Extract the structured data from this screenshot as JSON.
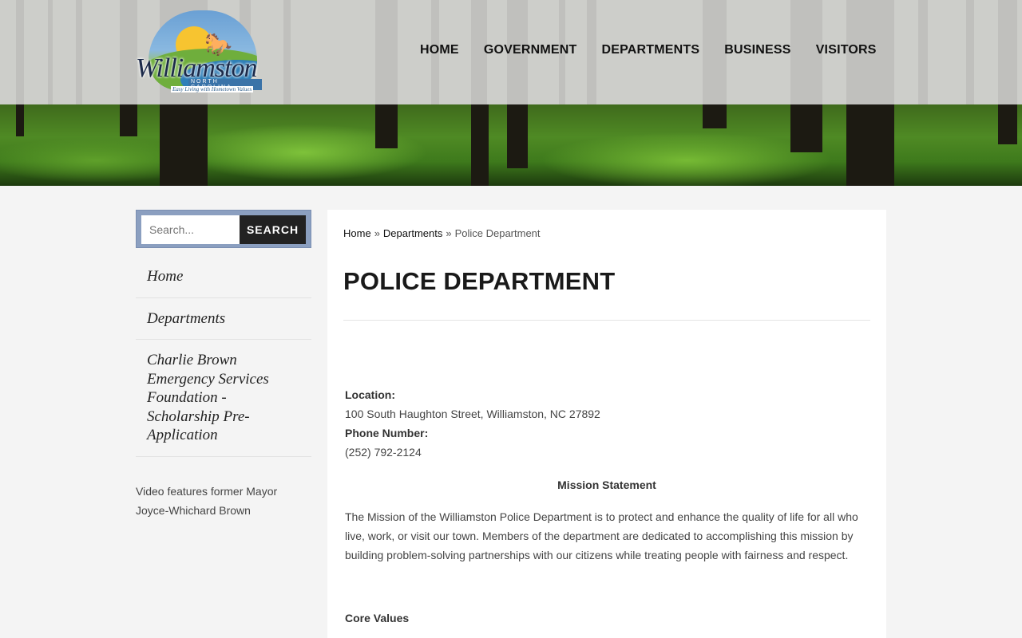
{
  "header": {
    "logo": {
      "wordmark": "Williamston",
      "state": "NORTH CAROLINA",
      "tagline": "Easy Living with Hometown Values"
    },
    "nav": [
      "HOME",
      "GOVERNMENT",
      "DEPARTMENTS",
      "BUSINESS",
      "VISITORS"
    ]
  },
  "sidebar": {
    "search_placeholder": "Search...",
    "search_button": "SEARCH",
    "menu": [
      "Home",
      "Departments",
      "Charlie Brown Emergency Services Foundation - Scholarship Pre-Application"
    ],
    "note": "Video features former Mayor Joyce-Whichard Brown"
  },
  "content": {
    "breadcrumb": {
      "home": "Home",
      "separator": "»",
      "departments": "Departments",
      "current": "Police Department"
    },
    "title": "POLICE DEPARTMENT",
    "location_label": "Location:",
    "location_value": "100 South Haughton Street, Williamston, NC 27892",
    "phone_label": "Phone Number:",
    "phone_value": "(252) 792-2124",
    "mission_heading": "Mission Statement",
    "mission_text": "The Mission of the Williamston Police Department is to protect and enhance the quality of life for all who live, work, or visit our town.  Members of the department are dedicated to accomplishing this mission by building problem-solving partnerships with our citizens while treating people with fairness and respect.",
    "core_values_heading": "Core Values"
  }
}
